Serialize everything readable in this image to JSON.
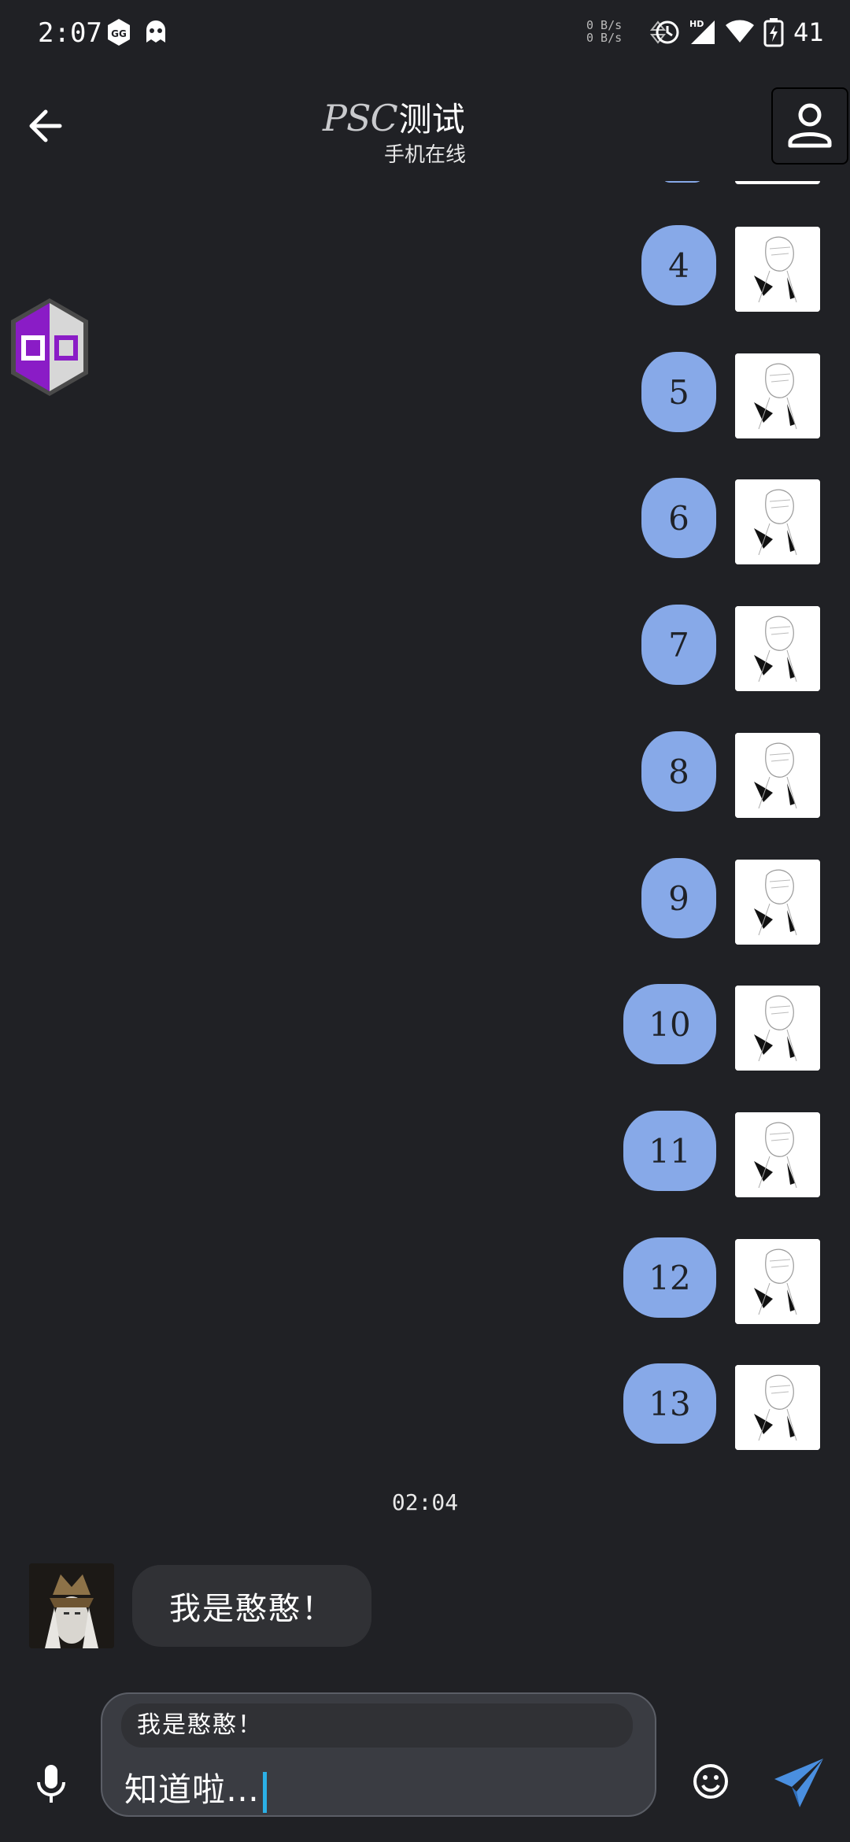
{
  "status_bar": {
    "time": "2:07",
    "speed_up": "0 B/s",
    "speed_down": "0 B/s",
    "battery": "41",
    "icons": [
      "gameguardian-icon",
      "ghost-icon",
      "alarm-icon",
      "hd-signal-icon",
      "wifi-icon",
      "battery-charging-icon"
    ]
  },
  "header": {
    "title_prefix": "PSC",
    "title": "测试",
    "subtitle": "手机在线"
  },
  "messages": {
    "sent_numbers": [
      "4",
      "5",
      "6",
      "7",
      "8",
      "9",
      "10",
      "11",
      "12",
      "13"
    ],
    "timestamp": "02:04",
    "received_text": "我是憨憨！"
  },
  "composer": {
    "reply_preview": "我是憨憨！",
    "input_text": "知道啦…"
  },
  "colors": {
    "background": "#202125",
    "sent_bubble": "#87a9e8",
    "received_bubble": "#303135",
    "send_accent": "#4a8fe0",
    "caret": "#2bb0e6"
  }
}
